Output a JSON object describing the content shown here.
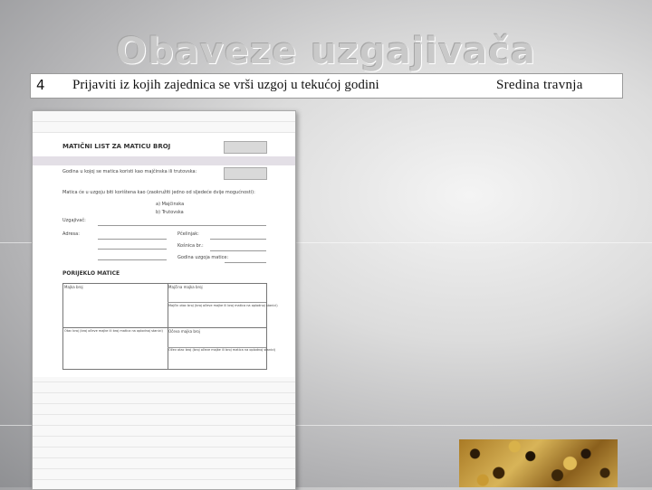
{
  "slide": {
    "title": "Obaveze uzgajivača",
    "row": {
      "number": "4",
      "task": "Prijaviti iz kojih zajednica se vrši uzgoj u tekućoj godini",
      "deadline": "Sredina travnja"
    }
  },
  "document": {
    "heading": "MATIČNI LIST ZA MATICU BROJ",
    "year_label": "Godina u kojoj se matica koristi kao majčinska ili trutovska:",
    "usage_label": "Matica će u uzgoju biti korištena kao (zaokružiti jedno od sljedeće dvije mogućnosti):",
    "option_a": "a)  Majčinska",
    "option_b": "b)  Trutovska",
    "breeder_label": "Uzgajivač:",
    "address_label": "Adresa:",
    "apiary_label": "Pčelinjak:",
    "hive_label": "Košnica br.:",
    "year_raised_label": "Godina uzgoja matice:",
    "origin_heading": "PORIJEKLO MATICE",
    "cell_mother": "Majka broj",
    "cell_mothers_mother": "Majčina majka broj",
    "cell_mothers_father": "Majčin otac broj (broj očeve majke ili broj matica na oplodnoj stanici)",
    "cell_father": "Otac broj (broj očeve majke ili broj matica na oplodnoj stanici)",
    "cell_fathers_mother": "Očeva majka broj",
    "cell_fathers_father": "Očev otac broj (broj očeve majke ili broj matica na oplodnoj stanici)"
  }
}
